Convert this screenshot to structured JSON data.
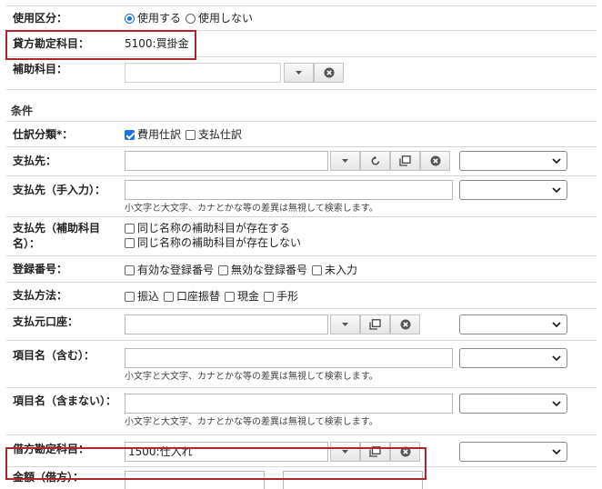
{
  "top": {
    "usage": {
      "label": "使用区分：",
      "options": [
        "使用する",
        "使用しない"
      ],
      "selected": "使用する"
    },
    "credit_account": {
      "label": "貸方勘定科目：",
      "value": "5100:買掛金"
    },
    "sub_account": {
      "label": "補助科目：",
      "value": ""
    }
  },
  "conditions": {
    "section_title": "条件",
    "journal_type": {
      "label": "仕訳分類*：",
      "options": [
        {
          "text": "費用仕訳",
          "checked": true
        },
        {
          "text": "支払仕訳",
          "checked": false
        }
      ]
    },
    "payee": {
      "label": "支払先：",
      "value": ""
    },
    "payee_manual": {
      "label": "支払先（手入力）：",
      "value": "",
      "hint": "小文字と大文字、カナとかな等の差異は無視して検索します。"
    },
    "payee_sub": {
      "label": "支払先（補助科目名）：",
      "options": [
        {
          "text": "同じ名称の補助科目が存在する",
          "checked": false
        },
        {
          "text": "同じ名称の補助科目が存在しない",
          "checked": false
        }
      ]
    },
    "registration": {
      "label": "登録番号：",
      "options": [
        {
          "text": "有効な登録番号",
          "checked": false
        },
        {
          "text": "無効な登録番号",
          "checked": false
        },
        {
          "text": "未入力",
          "checked": false
        }
      ]
    },
    "payment_method": {
      "label": "支払方法：",
      "options": [
        {
          "text": "振込",
          "checked": false
        },
        {
          "text": "口座振替",
          "checked": false
        },
        {
          "text": "現金",
          "checked": false
        },
        {
          "text": "手形",
          "checked": false
        }
      ]
    },
    "source_account": {
      "label": "支払元口座：",
      "value": ""
    },
    "item_contains": {
      "label": "項目名（含む）：",
      "value": "",
      "hint": "小文字と大文字、カナとかな等の差異は無視して検索します。"
    },
    "item_excludes": {
      "label": "項目名（含まない）：",
      "value": "",
      "hint": "小文字と大文字、カナとかな等の差異は無視して検索します。"
    },
    "debit_account": {
      "label": "借方勘定科目：",
      "value": "1500:仕入れ"
    },
    "amount": {
      "label": "金額（借方）："
    }
  },
  "icons": {
    "dropdown": "chevron-down-icon",
    "clear": "clear-x-icon",
    "reset": "refresh-icon",
    "copy": "copy-icon"
  },
  "colors": {
    "highlight": "#b1262c",
    "accent": "#1a73e8",
    "border": "#d6d6d6"
  }
}
